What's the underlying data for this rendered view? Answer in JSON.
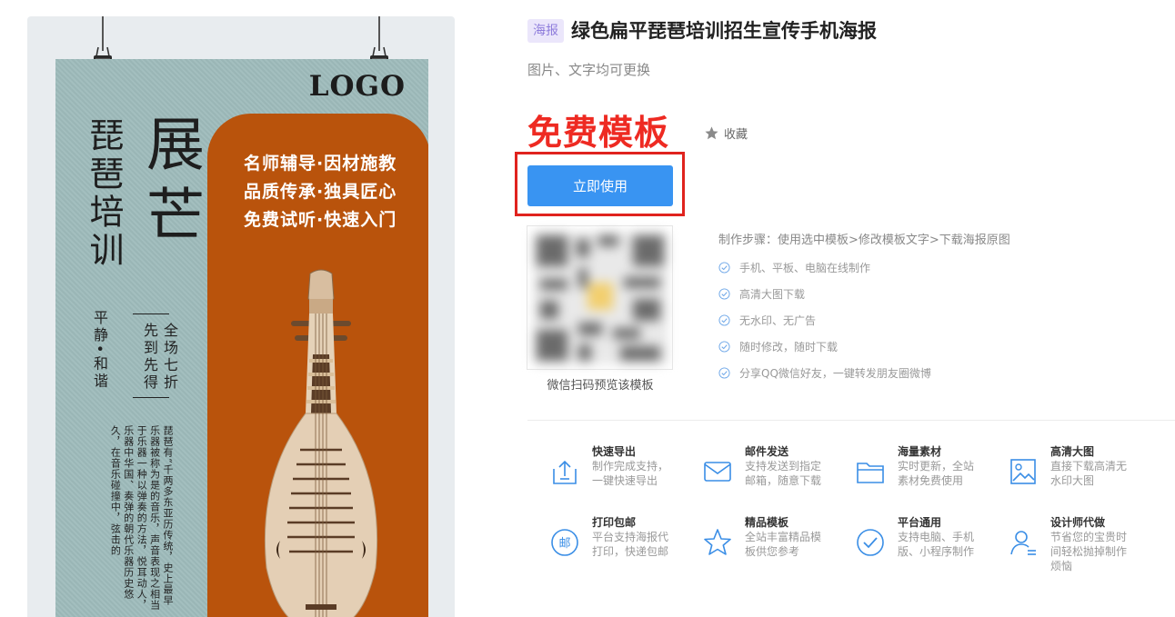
{
  "poster": {
    "logo": "LOGO",
    "title_small": "琵琶培训",
    "title_big": "展芒",
    "sub_left": "平静•和谐",
    "sub_right_a": "全场七折",
    "sub_right_b": "先到先得",
    "slogans": [
      "名师辅导·因材施教",
      "品质传承·独具匠心",
      "免费试听·快速入门"
    ],
    "poem": "琵琶有“千两多东亚历传统，史上最早乐器被称为是的音乐，声音表现之相当于乐器一种以弹奏的方法，悦耳动人，乐器中华国、奏弹的朝代乐器历史悠久，在音乐碰撞中，弦击的"
  },
  "template": {
    "type_badge": "海报",
    "title": "绿色扁平琵琶培训招生宣传手机海报",
    "subtitle": "图片、文字均可更换",
    "price_label": "免费模板",
    "favorite_label": "收藏",
    "use_button": "立即使用"
  },
  "qr": {
    "caption": "微信扫码预览该模板"
  },
  "steps": {
    "title": "制作步骤：使用选中模板>修改模板文字>下载海报原图",
    "items": [
      "手机、平板、电脑在线制作",
      "高清大图下载",
      "无水印、无广告",
      "随时修改，随时下载",
      "分享QQ微信好友，一键转发朋友圈微博"
    ]
  },
  "features": [
    {
      "icon": "export-icon",
      "title": "快速导出",
      "desc": "制作完成支持，一键快速导出"
    },
    {
      "icon": "mail-icon",
      "title": "邮件发送",
      "desc": "支持发送到指定邮箱，随意下载"
    },
    {
      "icon": "folder-icon",
      "title": "海量素材",
      "desc": "实时更新，全站素材免费使用"
    },
    {
      "icon": "image-icon",
      "title": "高清大图",
      "desc": "直接下载高清无水印大图"
    },
    {
      "icon": "post-icon",
      "title": "打印包邮",
      "desc": "平台支持海报代打印，快递包邮"
    },
    {
      "icon": "star-icon",
      "title": "精品模板",
      "desc": "全站丰富精品模板供您参考"
    },
    {
      "icon": "check-circle-icon",
      "title": "平台通用",
      "desc": "支持电脑、手机版、小程序制作"
    },
    {
      "icon": "designer-icon",
      "title": "设计师代做",
      "desc": "节省您的宝贵时间轻松抛掉制作烦恼"
    }
  ],
  "colors": {
    "accent": "#3994f2",
    "price_red": "#ee2a22",
    "poster_bg": "#9fbcbc",
    "poster_orange": "#b9530c"
  }
}
